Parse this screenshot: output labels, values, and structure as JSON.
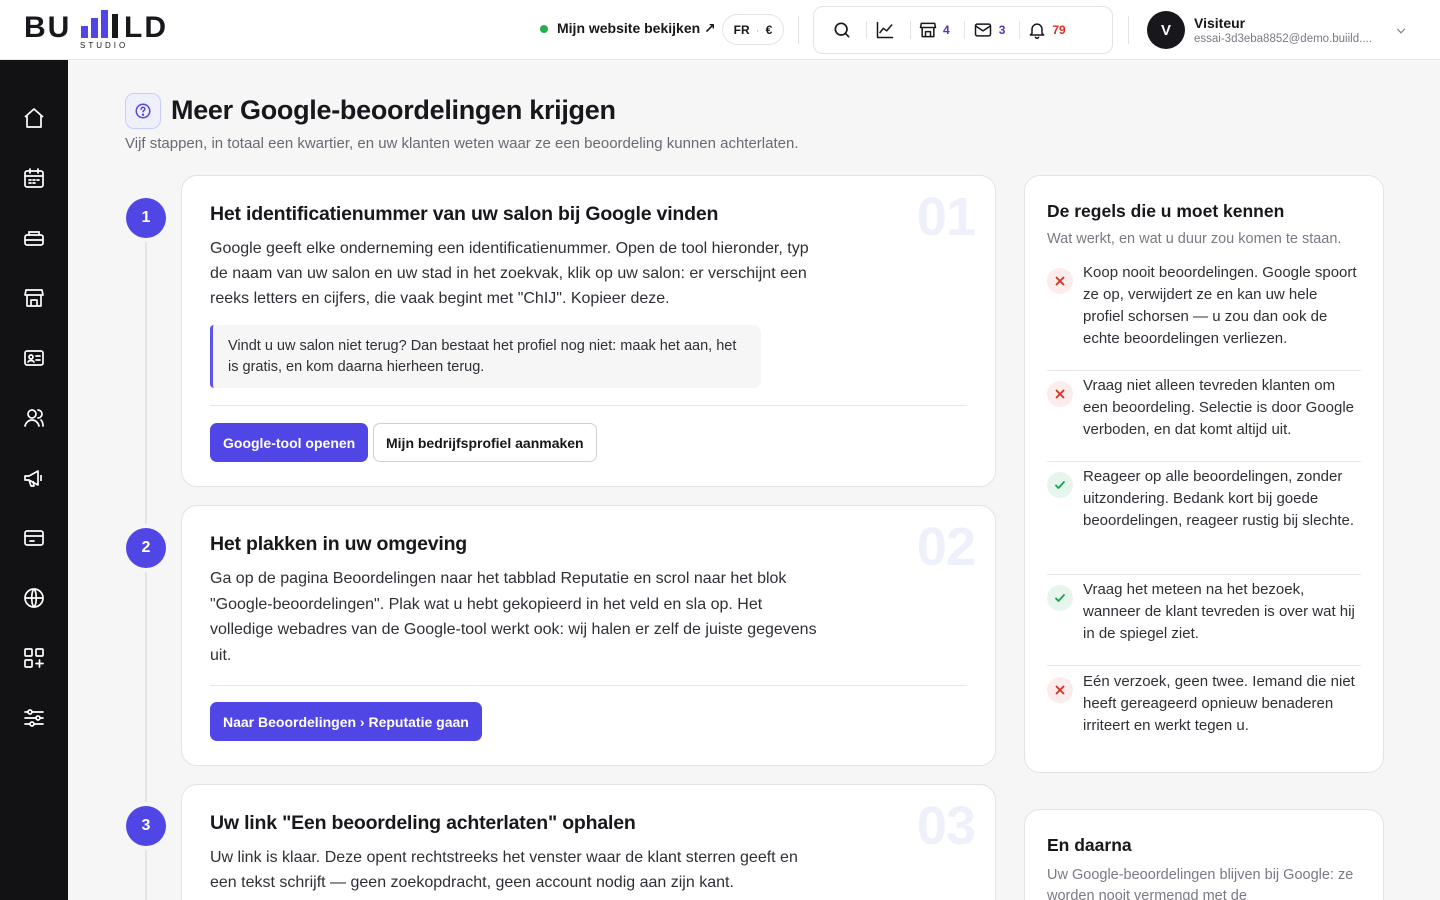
{
  "brand": {
    "name": "BUILD",
    "sub": "STUDIO"
  },
  "topbar": {
    "website_link": "Mijn website bekijken ↗",
    "lang": "FR",
    "currency": "€",
    "counts": {
      "shop": "4",
      "mail": "3",
      "notifications": "79"
    }
  },
  "user": {
    "initial": "V",
    "name": "Visiteur",
    "email": "essai-3d3eba8852@demo.buiild...."
  },
  "sidebar": {
    "icons": [
      "home-icon",
      "calendar-icon",
      "services-icon",
      "store-icon",
      "contact-card-icon",
      "customers-icon",
      "megaphone-icon",
      "payments-icon",
      "globe-icon",
      "apps-icon",
      "settings-sliders-icon"
    ]
  },
  "header": {
    "title": "Meer Google-beoordelingen krijgen",
    "subtitle": "Vijf stappen, in totaal een kwartier, en uw klanten weten waar ze een beoordeling kunnen achterlaten."
  },
  "steps": [
    {
      "number": "1",
      "big": "01",
      "title": "Het identificatienummer van uw salon bij Google vinden",
      "text": "Google geeft elke onderneming een identificatienummer. Open de tool hieronder, typ de naam van uw salon en uw stad in het zoekvak, klik op uw salon: er verschijnt een reeks letters en cijfers, die vaak begint met \"ChIJ\". Kopieer deze.",
      "callout": "Vindt u uw salon niet terug? Dan bestaat het profiel nog niet: maak het aan, het is gratis, en kom daarna hierheen terug.",
      "primary": "Google-tool openen",
      "secondary": "Mijn bedrijfsprofiel aanmaken"
    },
    {
      "number": "2",
      "big": "02",
      "title": "Het plakken in uw omgeving",
      "text": "Ga op de pagina Beoordelingen naar het tabblad Reputatie en scrol naar het blok \"Google-beoordelingen\". Plak wat u hebt gekopieerd in het veld en sla op. Het volledige webadres van de Google-tool werkt ook: wij halen er zelf de juiste gegevens uit.",
      "primary": "Naar Beoordelingen › Reputatie gaan"
    },
    {
      "number": "3",
      "big": "03",
      "title": "Uw link \"Een beoordeling achterlaten\" ophalen",
      "text": "Uw link is klaar. Deze opent rechtstreeks het venster waar de klant sterren geeft en een tekst schrijft — geen zoekopdracht, geen account nodig aan zijn kant."
    }
  ],
  "rules": {
    "title": "De regels die u moet kennen",
    "subtitle": "Wat werkt, en wat u duur zou komen te staan.",
    "items": [
      {
        "type": "no",
        "text": "Koop nooit beoordelingen. Google spoort ze op, verwijdert ze en kan uw hele profiel schorsen — u zou dan ook de echte beoordelingen verliezen."
      },
      {
        "type": "no",
        "text": "Vraag niet alleen tevreden klanten om een beoordeling. Selectie is door Google verboden, en dat komt altijd uit."
      },
      {
        "type": "yes",
        "text": "Reageer op alle beoordelingen, zonder uitzondering. Bedank kort bij goede beoordelingen, reageer rustig bij slechte."
      },
      {
        "type": "yes",
        "text": "Vraag het meteen na het bezoek, wanneer de klant tevreden is over wat hij in de spiegel ziet."
      },
      {
        "type": "no",
        "text": "Eén verzoek, geen twee. Iemand die niet heeft gereageerd opnieuw benaderen irriteert en werkt tegen u."
      }
    ]
  },
  "next": {
    "title": "En daarna",
    "text": "Uw Google-beoordelingen blijven bij Google: ze worden nooit vermengd met de"
  },
  "colors": {
    "accent": "#5046e5",
    "sidebar": "#121214",
    "danger": "#d92d20",
    "success": "#16a34a"
  }
}
